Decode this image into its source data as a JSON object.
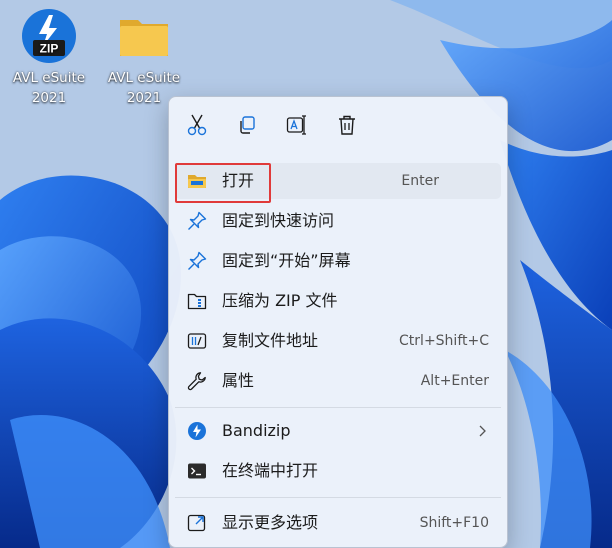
{
  "desktop": {
    "icons": [
      {
        "label": "AVL eSuite\n2021",
        "icon": "zip-app-icon"
      },
      {
        "label": "AVL eSuite\n2021",
        "icon": "folder-icon"
      }
    ]
  },
  "context_menu": {
    "toolbar": [
      {
        "name": "cut",
        "icon": "scissors-icon"
      },
      {
        "name": "copy",
        "icon": "copy-icon"
      },
      {
        "name": "rename",
        "icon": "rename-icon"
      },
      {
        "name": "delete",
        "icon": "trash-icon"
      }
    ],
    "items": [
      {
        "label": "打开",
        "shortcut": "Enter",
        "icon": "folder-open-icon"
      },
      {
        "label": "固定到快速访问",
        "shortcut": "",
        "icon": "pin-icon"
      },
      {
        "label": "固定到“开始”屏幕",
        "shortcut": "",
        "icon": "pin-icon"
      },
      {
        "label": "压缩为 ZIP 文件",
        "shortcut": "",
        "icon": "zip-folder-icon"
      },
      {
        "label": "复制文件地址",
        "shortcut": "Ctrl+Shift+C",
        "icon": "copy-path-icon"
      },
      {
        "label": "属性",
        "shortcut": "Alt+Enter",
        "icon": "wrench-icon"
      },
      {
        "label": "Bandizip",
        "shortcut": "",
        "icon": "bandizip-icon"
      },
      {
        "label": "在终端中打开",
        "shortcut": "",
        "icon": "terminal-icon"
      },
      {
        "label": "显示更多选项",
        "shortcut": "Shift+F10",
        "icon": "more-options-icon"
      }
    ]
  },
  "colors": {
    "accent": "#1a73d9",
    "highlight_border": "#e03a3a",
    "folder_yellow": "#f4c54a"
  }
}
